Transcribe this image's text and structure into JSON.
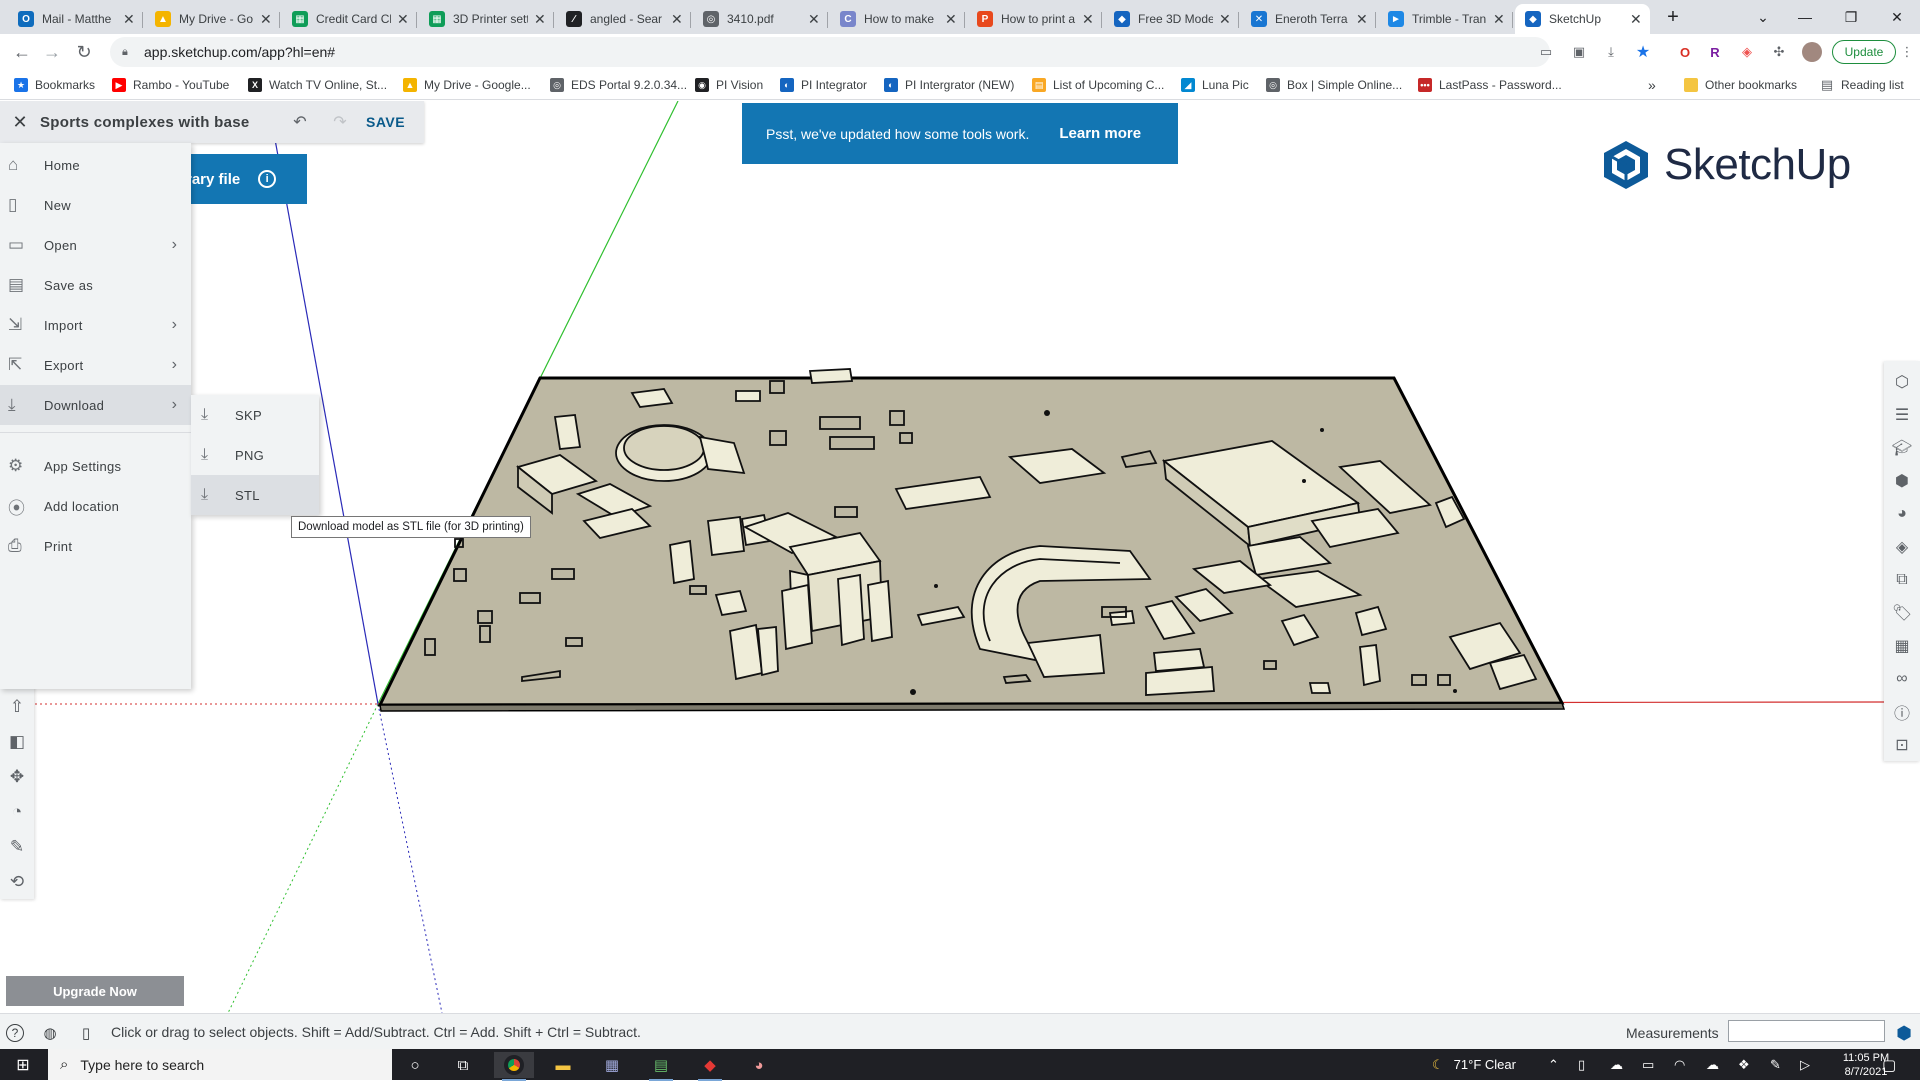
{
  "browser": {
    "tabs": [
      {
        "label": "Mail - Matthe",
        "icon": "outlook-icon",
        "color": "#0f6cbd",
        "glyph": "O"
      },
      {
        "label": "My Drive - Go",
        "icon": "drive-icon",
        "color": "#f4b400",
        "glyph": "▲"
      },
      {
        "label": "Credit Card Cl",
        "icon": "sheets-icon",
        "color": "#0f9d58",
        "glyph": "▦"
      },
      {
        "label": "3D Printer sett",
        "icon": "sheets-icon",
        "color": "#0f9d58",
        "glyph": "▦"
      },
      {
        "label": "angled - Sear",
        "icon": "angle-icon",
        "color": "#202124",
        "glyph": "∕"
      },
      {
        "label": "3410.pdf",
        "icon": "globe-icon",
        "color": "#5f6368",
        "glyph": "◎"
      },
      {
        "label": "How to make",
        "icon": "c-icon",
        "color": "#7986cb",
        "glyph": "C"
      },
      {
        "label": "How to print a",
        "icon": "p-icon",
        "color": "#e8491d",
        "glyph": "P"
      },
      {
        "label": "Free 3D Mode",
        "icon": "sketchup-icon",
        "color": "#1565c0",
        "glyph": "◆"
      },
      {
        "label": "Eneroth Terra",
        "icon": "x-icon",
        "color": "#1976d2",
        "glyph": "✕"
      },
      {
        "label": "Trimble - Tran",
        "icon": "trimble-icon",
        "color": "#1e88e5",
        "glyph": "►"
      },
      {
        "label": "SketchUp",
        "icon": "sketchup-icon",
        "color": "#1565c0",
        "glyph": "◆"
      }
    ],
    "url": "app.sketchup.com/app?hl=en#",
    "update_label": "Update",
    "bookmarks": [
      {
        "label": "Bookmarks",
        "icon": "star-icon",
        "color": "#1a73e8",
        "glyph": "★"
      },
      {
        "label": "Rambo - YouTube",
        "icon": "youtube-icon",
        "color": "#ff0000",
        "glyph": "▶"
      },
      {
        "label": "Watch TV Online, St...",
        "icon": "x-icon",
        "color": "#202124",
        "glyph": "X"
      },
      {
        "label": "My Drive - Google...",
        "icon": "drive-icon",
        "color": "#f4b400",
        "glyph": "▲"
      },
      {
        "label": "EDS Portal 9.2.0.34...",
        "icon": "globe-icon",
        "color": "#5f6368",
        "glyph": "◎"
      },
      {
        "label": "PI Vision",
        "icon": "pi-icon",
        "color": "#202124",
        "glyph": "◉"
      },
      {
        "label": "PI Integrator",
        "icon": "pi-icon",
        "color": "#1565c0",
        "glyph": "◐"
      },
      {
        "label": "PI Intergrator (NEW)",
        "icon": "pi-icon",
        "color": "#1565c0",
        "glyph": "◐"
      },
      {
        "label": "List of Upcoming C...",
        "icon": "calendar-icon",
        "color": "#f9a825",
        "glyph": "▤"
      },
      {
        "label": "Luna Pic",
        "icon": "lunapic-icon",
        "color": "#0288d1",
        "glyph": "◢"
      },
      {
        "label": "Box | Simple Online...",
        "icon": "globe-icon",
        "color": "#5f6368",
        "glyph": "◎"
      },
      {
        "label": "LastPass - Password...",
        "icon": "lastpass-icon",
        "color": "#c62828",
        "glyph": "•••"
      }
    ],
    "more_label": "»",
    "other_bookmarks": "Other bookmarks",
    "reading_list": "Reading list"
  },
  "app": {
    "model_title": "Sports complexes with base",
    "save_label": "SAVE",
    "library_banner": "rary file",
    "notice_text": "Psst, we've updated how some tools work.",
    "notice_link": "Learn more",
    "logo_text": "SketchUp",
    "upgrade_label": "Upgrade Now",
    "menu": [
      {
        "label": "Home",
        "icon": "home-icon",
        "glyph": "⌂",
        "chevron": false
      },
      {
        "label": "New",
        "icon": "new-file-icon",
        "glyph": "▯",
        "chevron": false
      },
      {
        "label": "Open",
        "icon": "folder-icon",
        "glyph": "▭",
        "chevron": true
      },
      {
        "label": "Save as",
        "icon": "save-as-icon",
        "glyph": "▤",
        "chevron": false
      },
      {
        "label": "Import",
        "icon": "import-icon",
        "glyph": "⇲",
        "chevron": true
      },
      {
        "label": "Export",
        "icon": "export-icon",
        "glyph": "⇱",
        "chevron": true
      },
      {
        "label": "Download",
        "icon": "download-icon",
        "glyph": "⤓",
        "chevron": true
      },
      {
        "label": "App Settings",
        "icon": "gear-icon",
        "glyph": "⚙",
        "chevron": false
      },
      {
        "label": "Add location",
        "icon": "location-pin-icon",
        "glyph": "⦿",
        "chevron": false
      },
      {
        "label": "Print",
        "icon": "printer-icon",
        "glyph": "⎙",
        "chevron": false
      }
    ],
    "download_submenu": [
      {
        "label": "SKP",
        "icon": "download-icon",
        "glyph": "⤓"
      },
      {
        "label": "PNG",
        "icon": "download-icon",
        "glyph": "⤓"
      },
      {
        "label": "STL",
        "icon": "download-icon",
        "glyph": "⤓"
      }
    ],
    "tooltip": "Download model as STL file (for 3D printing)",
    "status_hint": "Click or drag to select objects. Shift = Add/Subtract. Ctrl = Add. Shift + Ctrl = Subtract.",
    "measurements_label": "Measurements",
    "measurements_value": "",
    "accent": "#1376b3"
  },
  "taskbar": {
    "search_placeholder": "Type here to search",
    "weather": "71°F  Clear",
    "time": "11:05 PM",
    "date": "8/7/2021"
  }
}
